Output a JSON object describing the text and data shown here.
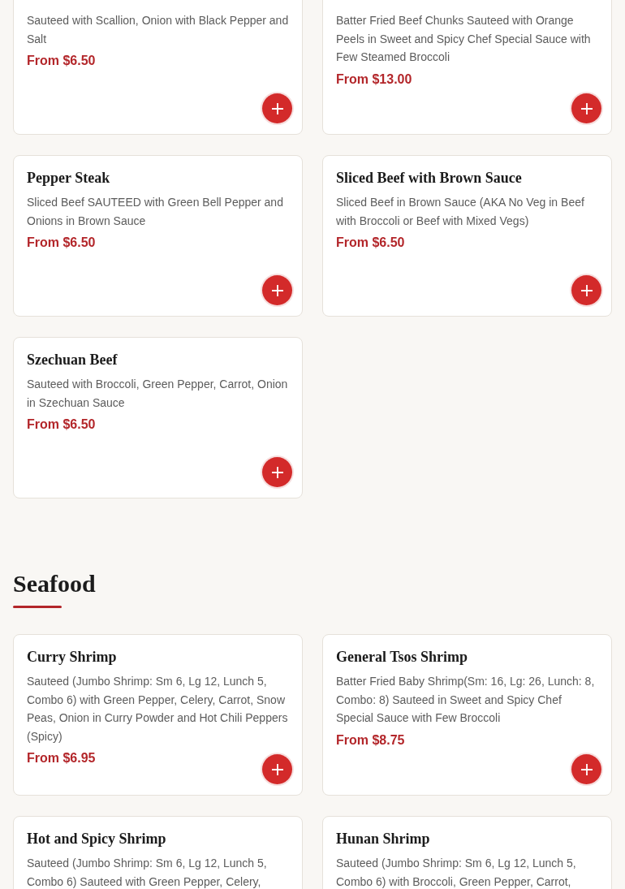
{
  "sections": [
    {
      "dishes": [
        {
          "description": "Sauteed with Scallion, Onion with Black Pepper and Salt",
          "price": "From $6.50"
        },
        {
          "description": "Batter Fried Beef Chunks Sauteed with Orange Peels in Sweet and Spicy Chef Special Sauce with Few Steamed Broccoli",
          "price": "From $13.00"
        },
        {
          "name": "Pepper Steak",
          "description": "Sliced Beef SAUTEED with Green Bell Pepper and Onions in Brown Sauce",
          "price": "From $6.50"
        },
        {
          "name": "Sliced Beef with Brown Sauce",
          "description": "Sliced Beef in Brown Sauce (AKA No Veg in Beef with Broccoli or Beef with Mixed Vegs)",
          "price": "From $6.50"
        },
        {
          "name": "Szechuan Beef",
          "description": "Sauteed with Broccoli, Green Pepper, Carrot, Onion in Szechuan Sauce",
          "price": "From $6.50"
        }
      ]
    },
    {
      "title": "Seafood",
      "dishes": [
        {
          "name": "Curry Shrimp",
          "description": "Sauteed (Jumbo Shrimp: Sm 6, Lg 12, Lunch 5, Combo 6) with Green Pepper, Celery, Carrot, Snow Peas, Onion in Curry Powder and Hot Chili Peppers (Spicy)",
          "price": "From $6.95"
        },
        {
          "name": "General Tsos Shrimp",
          "description": "Batter Fried Baby Shrimp(Sm: 16, Lg: 26, Lunch: 8, Combo: 8) Sauteed in Sweet and Spicy Chef Special Sauce with Few Broccoli",
          "price": "From $8.75"
        },
        {
          "name": "Hot and Spicy Shrimp",
          "description": "Sauteed (Jumbo Shrimp: Sm 6, Lg 12, Lunch 5, Combo 6) Sauteed with Green Pepper, Celery,"
        },
        {
          "name": "Hunan Shrimp",
          "description": "Sauteed (Jumbo Shrimp: Sm 6, Lg 12, Lunch 5, Combo 6) with Broccoli, Green Pepper, Carrot,"
        }
      ]
    }
  ]
}
